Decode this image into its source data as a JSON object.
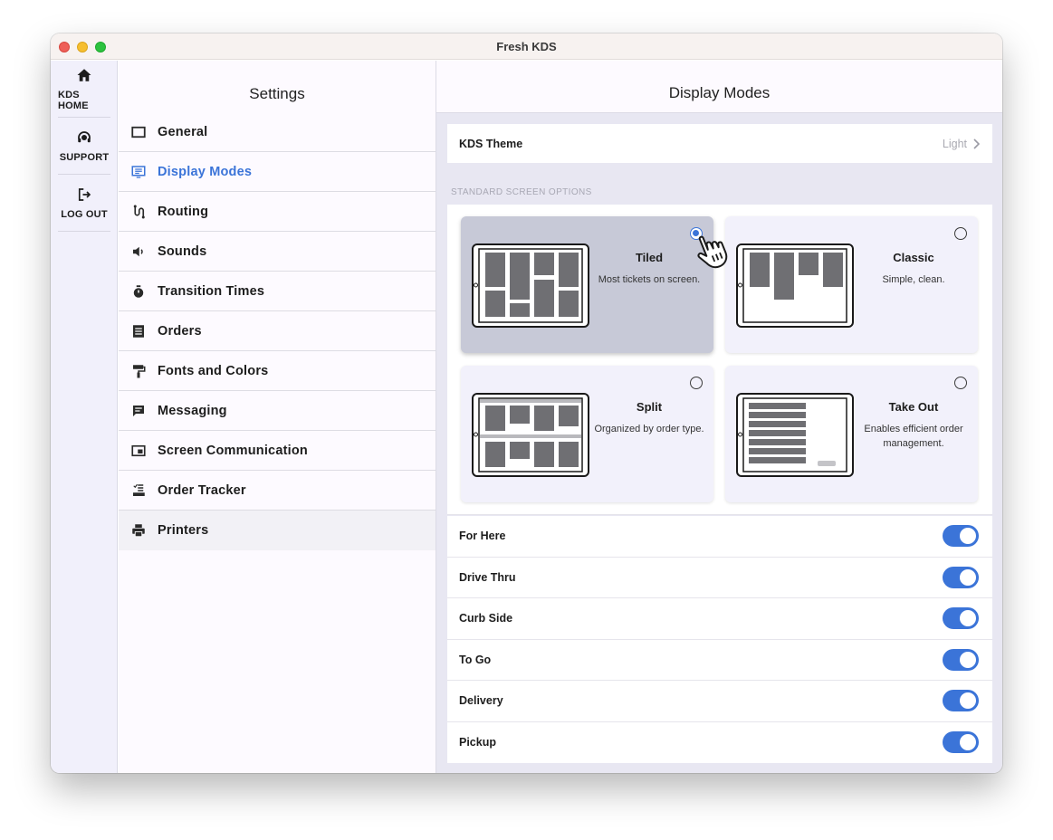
{
  "window": {
    "title": "Fresh KDS"
  },
  "rail": {
    "items": [
      {
        "label": "KDS HOME",
        "icon": "home-icon"
      },
      {
        "label": "SUPPORT",
        "icon": "headset-icon"
      },
      {
        "label": "LOG OUT",
        "icon": "logout-icon"
      }
    ]
  },
  "settings": {
    "title": "Settings",
    "items": [
      {
        "label": "General",
        "icon": "window-icon"
      },
      {
        "label": "Display Modes",
        "icon": "display-icon",
        "active": true
      },
      {
        "label": "Routing",
        "icon": "route-icon"
      },
      {
        "label": "Sounds",
        "icon": "speaker-icon"
      },
      {
        "label": "Transition Times",
        "icon": "stopwatch-icon"
      },
      {
        "label": "Orders",
        "icon": "list-icon"
      },
      {
        "label": "Fonts and Colors",
        "icon": "paint-roller-icon"
      },
      {
        "label": "Messaging",
        "icon": "message-icon"
      },
      {
        "label": "Screen Communication",
        "icon": "screen-icon"
      },
      {
        "label": "Order Tracker",
        "icon": "tracker-icon"
      },
      {
        "label": "Printers",
        "icon": "printer-icon"
      }
    ]
  },
  "content": {
    "title": "Display Modes",
    "theme": {
      "label": "KDS Theme",
      "value": "Light"
    },
    "section_caption": "STANDARD SCREEN OPTIONS",
    "modes": [
      {
        "title": "Tiled",
        "description": "Most tickets on screen.",
        "selected": true
      },
      {
        "title": "Classic",
        "description": "Simple, clean.",
        "selected": false
      },
      {
        "title": "Split",
        "description": "Organized by order type.",
        "selected": false
      },
      {
        "title": "Take Out",
        "description": "Enables efficient order management.",
        "selected": false
      }
    ],
    "order_types": [
      {
        "label": "For Here",
        "enabled": true
      },
      {
        "label": "Drive Thru",
        "enabled": true
      },
      {
        "label": "Curb Side",
        "enabled": true
      },
      {
        "label": "To Go",
        "enabled": true
      },
      {
        "label": "Delivery",
        "enabled": true
      },
      {
        "label": "Pickup",
        "enabled": true
      }
    ]
  },
  "colors": {
    "accent": "#3b74d8",
    "tile": "#6f6f73"
  }
}
